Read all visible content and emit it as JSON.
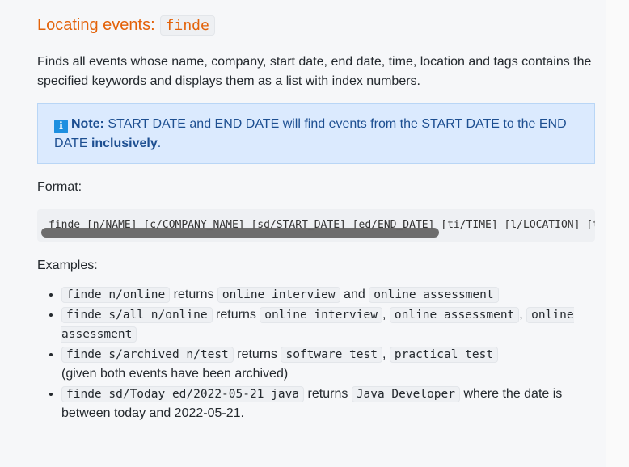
{
  "section": {
    "heading_text": "Locating events:",
    "heading_code": "finde",
    "description": "Finds all events whose name, company, start date, end date, time, location and tags contains the specified keywords and displays them as a list with index numbers."
  },
  "note": {
    "icon": "info-icon",
    "label": "Note:",
    "text_before": " START DATE and END DATE will find events from the START DATE to the END DATE ",
    "bold": "inclusively",
    "text_after": "."
  },
  "format": {
    "label": "Format:",
    "code": "finde [n/NAME] [c/COMPANY_NAME] [sd/START_DATE] [ed/END_DATE] [ti/TIME] [l/LOCATION] [t/TAG]…"
  },
  "examples": {
    "label": "Examples:",
    "items": [
      {
        "cmd": "finde n/online",
        "t1": " returns ",
        "r1": "online interview",
        "t2": " and ",
        "r2": "online assessment"
      },
      {
        "cmd": "finde s/all n/online",
        "t1": " returns ",
        "r1": "online interview",
        "t2": ", ",
        "r2": "online assessment",
        "t3": ", ",
        "r3": "online assessment"
      },
      {
        "cmd": "finde s/archived n/test",
        "t1": " returns ",
        "r1": "software test",
        "t2": ", ",
        "r2": "practical test",
        "note": "(given both events have been archived)"
      },
      {
        "cmd": "finde sd/Today ed/2022-05-21 java",
        "t1": " returns ",
        "r1": "Java Developer",
        "t2": " where the date is between today and 2022-05-21."
      }
    ]
  }
}
